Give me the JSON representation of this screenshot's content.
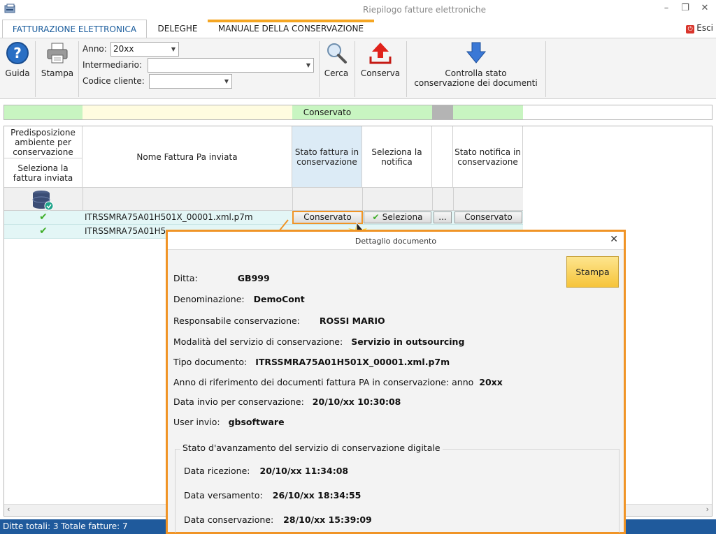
{
  "window": {
    "title": "Riepilogo fatture elettroniche",
    "exit_label": "Esci",
    "minimize": "–",
    "restore": "❐",
    "close": "✕"
  },
  "tabs": [
    {
      "label": "FATTURAZIONE ELETTRONICA"
    },
    {
      "label": "DELEGHE"
    },
    {
      "label": "MANUALE DELLA CONSERVAZIONE"
    }
  ],
  "ribbon": {
    "guida": "Guida",
    "stampa": "Stampa",
    "anno_label": "Anno:",
    "anno_value": "20xx",
    "intermediario_label": "Intermediario:",
    "intermediario_value": "",
    "codice_label": "Codice cliente:",
    "codice_value": "",
    "cerca": "Cerca",
    "conserva": "Conserva",
    "controlla_line1": "Controlla stato",
    "controlla_line2": "conservazione dei documenti"
  },
  "filter_strip": {
    "stato_fattura": "Conservato"
  },
  "grid": {
    "headers": {
      "predisposizione": "Predisposizione ambiente per conservazione",
      "seleziona_fattura": "Seleziona la fattura inviata",
      "nome_fattura": "Nome Fattura Pa inviata",
      "stato_fattura": "Stato fattura in conservazione",
      "seleziona_notifica": "Seleziona la notifica",
      "stato_notifica": "Stato notifica in conservazione"
    },
    "rows": [
      {
        "nome": "ITRSSMRA75A01H501X_00001.xml.p7m",
        "stato": "Conservato",
        "notifica_btn": "Seleziona",
        "dots": "...",
        "stato_notifica": "Conservato"
      },
      {
        "nome": "ITRSSMRA75A01H5",
        "stato": "",
        "notifica_btn": "",
        "dots": "",
        "stato_notifica": ""
      }
    ]
  },
  "status_bar": "Ditte totali: 3 Totale fatture: 7",
  "dialog": {
    "title": "Dettaglio documento",
    "print_button": "Stampa",
    "fields": {
      "ditta_label": "Ditta:",
      "ditta": "GB999",
      "denominazione_label": "Denominazione:",
      "denominazione": "DemoCont",
      "responsabile_label": "Responsabile conservazione:",
      "responsabile": "ROSSI MARIO",
      "modalita_label": "Modalità del servizio di conservazione:",
      "modalita": "Servizio in outsourcing",
      "tipo_label": "Tipo documento:",
      "tipo": "ITRSSMRA75A01H501X_00001.xml.p7m",
      "anno_label": "Anno di riferimento dei documenti fattura PA in conservazione: anno",
      "anno": "20xx",
      "data_invio_label": "Data invio per conservazione:",
      "data_invio": "20/10/xx 10:30:08",
      "user_label": "User invio:",
      "user": "gbsoftware"
    },
    "group": {
      "title": "Stato d'avanzamento del servizio di conservazione digitale",
      "ricezione_label": "Data ricezione:",
      "ricezione": "20/10/xx 11:34:08",
      "versamento_label": "Data versamento:",
      "versamento": "26/10/xx 18:34:55",
      "conservazione_label": "Data conservazione:",
      "conservazione": "28/10/xx 15:39:09"
    }
  },
  "colors": {
    "accent_orange": "#f09426",
    "status_bar": "#1f5a9c",
    "tab_active_text": "#1a5c9c",
    "row_bg": "#e3f6f6",
    "check_green": "#3fae29"
  }
}
